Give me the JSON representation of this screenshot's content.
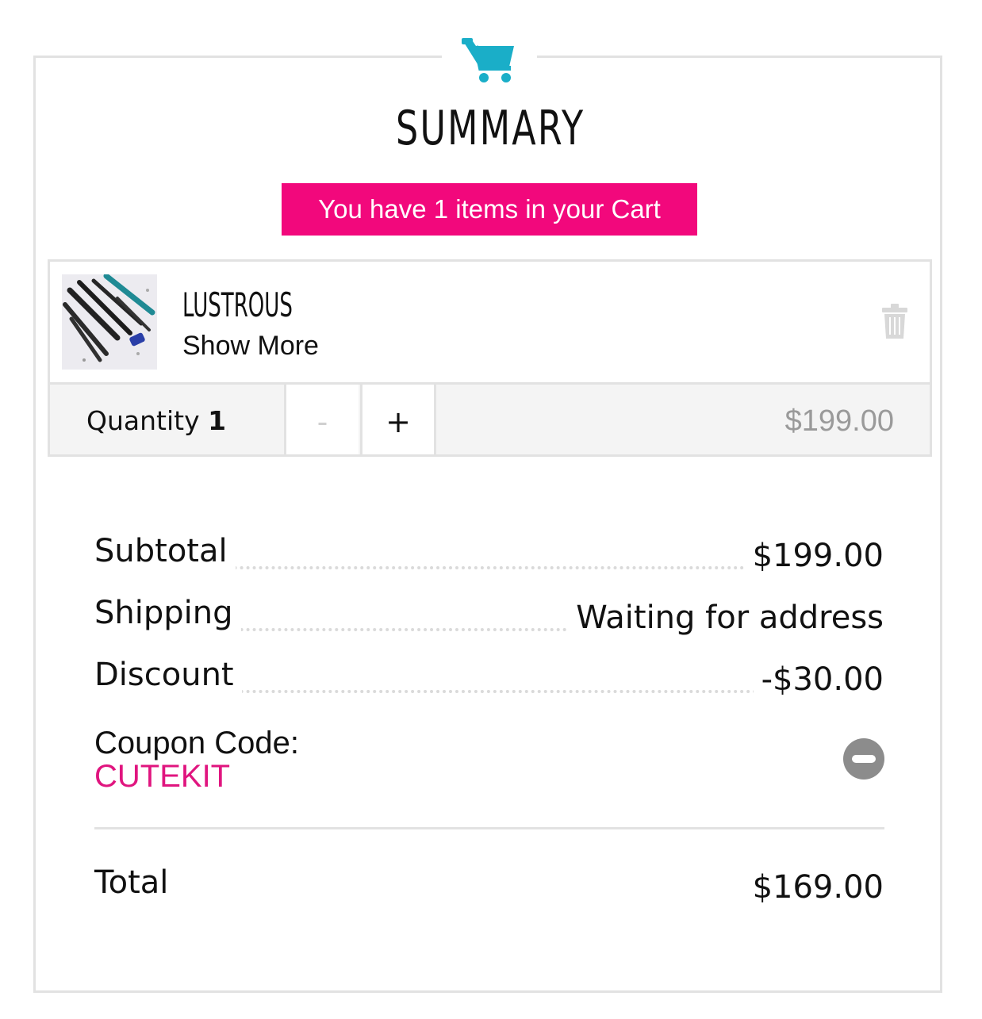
{
  "header": {
    "icon": "shopping-cart-icon",
    "title": "SUMMARY"
  },
  "banner": {
    "text": "You have 1 items in your Cart"
  },
  "cart_item": {
    "thumbnail": "product-photo",
    "name": "LUSTROUS",
    "show_more_label": "Show More",
    "remove_icon": "trash-icon",
    "quantity_label": "Quantity",
    "quantity_value": "1",
    "decrement_label": "-",
    "increment_label": "+",
    "line_price": "$199.00"
  },
  "summary": {
    "rows": [
      {
        "label": "Subtotal",
        "value": "$199.00"
      },
      {
        "label": "Shipping",
        "value": "Waiting for address"
      },
      {
        "label": "Discount",
        "value": "-$30.00"
      }
    ],
    "coupon_label": "Coupon Code:",
    "coupon_code": "CUTEKIT",
    "remove_coupon_icon": "minus-circle-icon",
    "total_label": "Total",
    "total_value": "$169.00"
  },
  "colors": {
    "accent_pink": "#f2087c",
    "coupon_pink": "#e0157f",
    "cart_icon_teal": "#1aaec8",
    "border_gray": "#e2e2e2",
    "muted_gray": "#9a9a9a"
  }
}
